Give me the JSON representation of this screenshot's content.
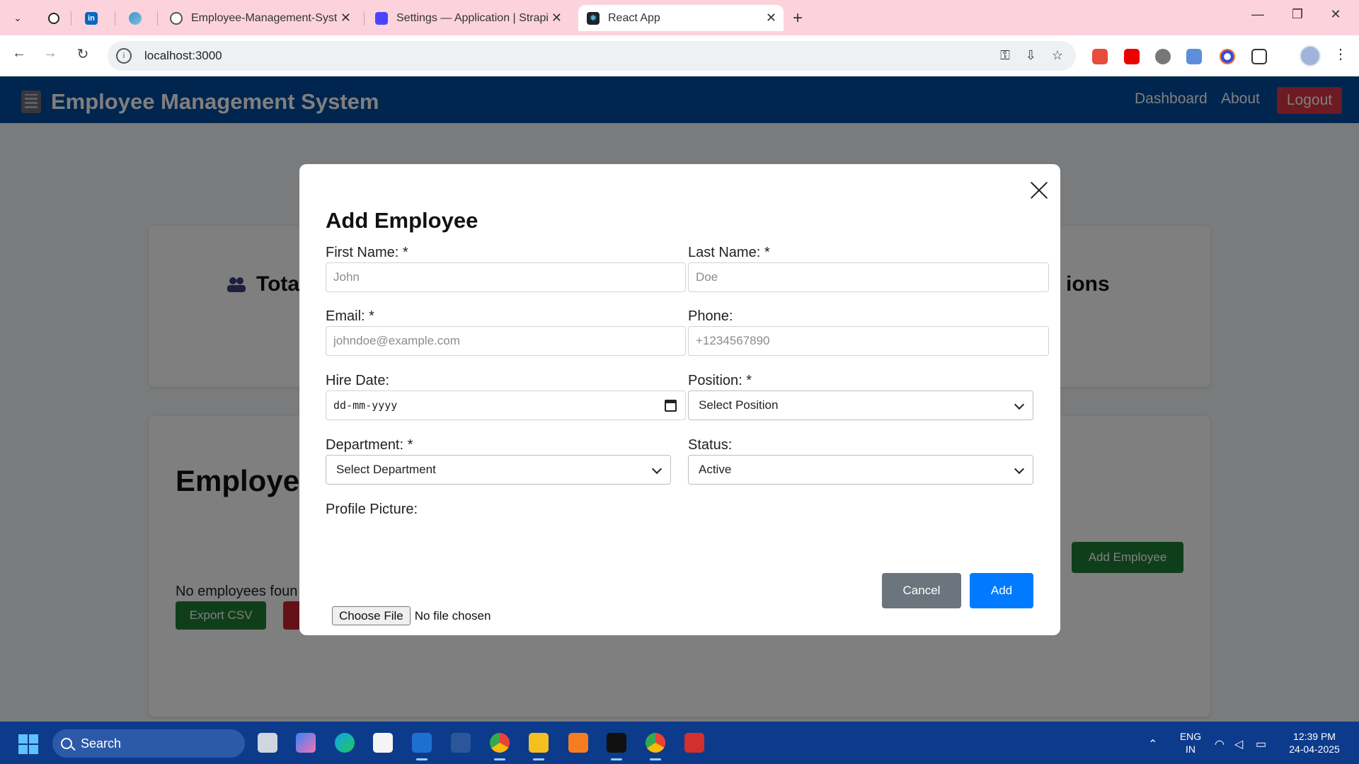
{
  "browser": {
    "tabs": [
      {
        "title": "",
        "icon": "openai-icon"
      },
      {
        "title": "",
        "icon": "linkedin-icon"
      },
      {
        "title": "",
        "icon": "copilot-icon"
      },
      {
        "title": "Employee-Management-Systen",
        "icon": "github-icon"
      },
      {
        "title": "Settings — Application | Strapi",
        "icon": "strapi-icon"
      },
      {
        "title": "React App",
        "icon": "react-icon",
        "active": true
      }
    ],
    "url": "localhost:3000"
  },
  "app": {
    "title": "Employee Management System",
    "nav": {
      "dashboard": "Dashboard",
      "about": "About",
      "logout": "Logout"
    },
    "stats": {
      "left_partial": "Tota",
      "right_partial": "ions"
    },
    "list": {
      "title": "Employee",
      "add_button": "Add Employee",
      "export_button": "Export CSV",
      "empty_message": "No employees foun"
    }
  },
  "modal": {
    "title": "Add Employee",
    "fields": {
      "first_name": {
        "label": "First Name: *",
        "placeholder": "John"
      },
      "last_name": {
        "label": "Last Name: *",
        "placeholder": "Doe"
      },
      "email": {
        "label": "Email: *",
        "placeholder": "johndoe@example.com"
      },
      "phone": {
        "label": "Phone:",
        "placeholder": "+1234567890"
      },
      "hire_date": {
        "label": "Hire Date:",
        "placeholder": "dd-mm-yyyy"
      },
      "position": {
        "label": "Position: *",
        "selected": "Select Position"
      },
      "department": {
        "label": "Department: *",
        "selected": "Select Department"
      },
      "status": {
        "label": "Status:",
        "selected": "Active"
      },
      "profile_picture": {
        "label": "Profile Picture:",
        "button": "Choose File",
        "status": "No file chosen"
      }
    },
    "buttons": {
      "cancel": "Cancel",
      "add": "Add"
    }
  },
  "taskbar": {
    "search": "Search",
    "language": "ENG",
    "region": "IN",
    "time": "12:39 PM",
    "date": "24-04-2025"
  },
  "colors": {
    "header": "#004a9f",
    "logout": "#dc3545",
    "primary": "#007bff",
    "secondary": "#6c757d",
    "success": "#1e7e34",
    "tabbar": "#fcd3dd",
    "taskbar": "#0d3b8c"
  }
}
